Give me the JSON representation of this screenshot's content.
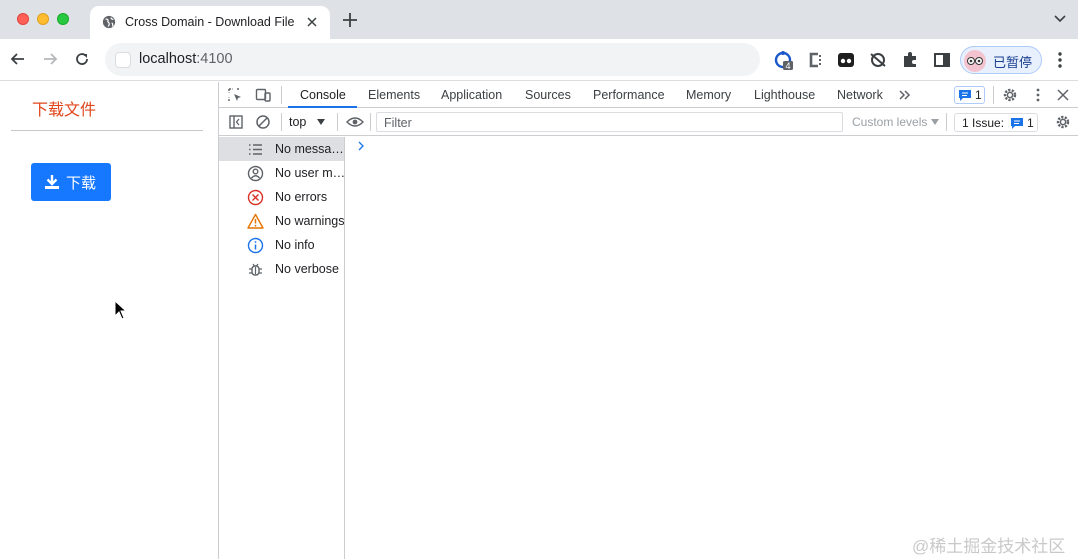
{
  "browser": {
    "tab": {
      "title": "Cross Domain - Download File"
    },
    "address": {
      "host": "localhost",
      "port": ":4100"
    },
    "extensions": {
      "badge_count": "4"
    },
    "profile": {
      "label": "已暂停"
    }
  },
  "page": {
    "title": "下载文件",
    "download_button": {
      "label": "下载",
      "color": "#1677ff"
    },
    "title_color": "#e0461b"
  },
  "devtools": {
    "tabs": [
      "Console",
      "Elements",
      "Application",
      "Sources",
      "Performance",
      "Memory",
      "Lighthouse",
      "Network"
    ],
    "active_tab": "Console",
    "messages_badge": {
      "count": "1"
    },
    "toolbar": {
      "context": "top",
      "filter_placeholder": "Filter",
      "levels": "Custom levels",
      "issues_label": "1 Issue:",
      "issues_count": "1"
    },
    "sidebar": [
      {
        "label": "No messa…",
        "icon": "list-icon"
      },
      {
        "label": "No user m…",
        "icon": "user-icon"
      },
      {
        "label": "No errors",
        "icon": "error-icon"
      },
      {
        "label": "No warnings",
        "icon": "warning-icon"
      },
      {
        "label": "No info",
        "icon": "info-icon"
      },
      {
        "label": "No verbose",
        "icon": "bug-icon"
      }
    ]
  },
  "watermark": "@稀土掘金技术社区"
}
